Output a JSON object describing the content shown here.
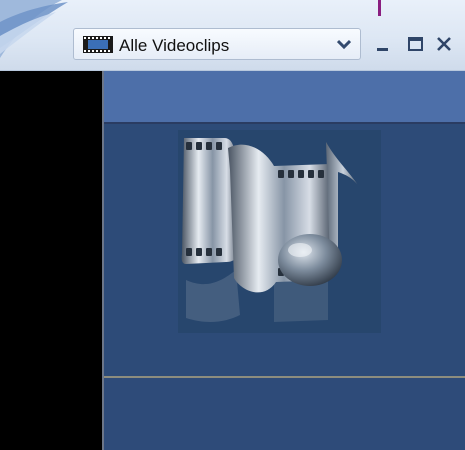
{
  "titlebar": {
    "dropdown": {
      "selected_label": "Alle Videoclips",
      "icon": "film-strip-icon",
      "chevron_icon": "chevron-down-icon"
    },
    "buttons": {
      "minimize_icon": "minimize-icon",
      "maximize_icon": "maximize-icon",
      "close_icon": "close-icon"
    }
  },
  "main": {
    "placeholder_art_icon": "film-music-note-icon"
  },
  "colors": {
    "titlebar_bg": "#dde7f4",
    "header_band": "#4d6fa9",
    "content_bg": "#2d4b78",
    "left_pane": "#000000",
    "marker": "#8a1e80"
  }
}
